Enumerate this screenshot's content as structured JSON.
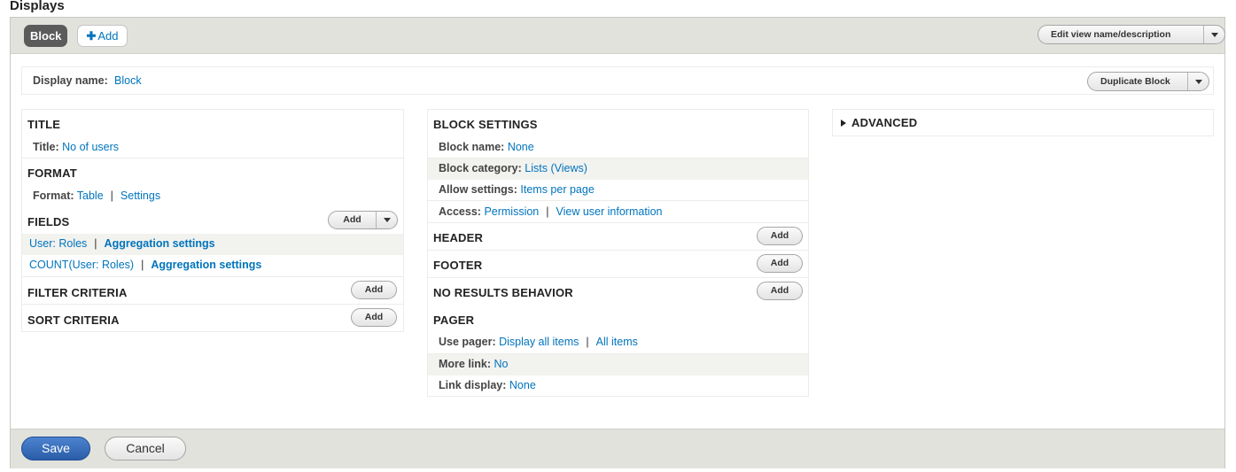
{
  "page": {
    "heading": "Displays"
  },
  "tabs": {
    "block": "Block",
    "add": "Add",
    "add_icon": "plus-icon"
  },
  "top_actions": {
    "edit_label": "Edit view name/description",
    "duplicate_label": "Duplicate Block"
  },
  "display": {
    "name_label": "Display name:",
    "name_value": "Block"
  },
  "left": {
    "title": {
      "heading": "TITLE",
      "label": "Title:",
      "value": "No of users"
    },
    "format": {
      "heading": "FORMAT",
      "label": "Format:",
      "value": "Table",
      "settings": "Settings"
    },
    "fields": {
      "heading": "FIELDS",
      "add": "Add",
      "items": [
        {
          "value": "User: Roles",
          "agg": "Aggregation settings"
        },
        {
          "value": "COUNT(User: Roles)",
          "agg": "Aggregation settings"
        }
      ]
    },
    "filter": {
      "heading": "FILTER CRITERIA",
      "add": "Add"
    },
    "sort": {
      "heading": "SORT CRITERIA",
      "add": "Add"
    }
  },
  "middle": {
    "block_settings": {
      "heading": "BLOCK SETTINGS",
      "name_label": "Block name:",
      "name_value": "None",
      "category_label": "Block category:",
      "category_value": "Lists (Views)",
      "allow_label": "Allow settings:",
      "allow_value": "Items per page",
      "access_label": "Access:",
      "access_value": "Permission",
      "access_value2": "View user information"
    },
    "header": {
      "heading": "HEADER",
      "add": "Add"
    },
    "footer": {
      "heading": "FOOTER",
      "add": "Add"
    },
    "no_results": {
      "heading": "NO RESULTS BEHAVIOR",
      "add": "Add"
    },
    "pager": {
      "heading": "PAGER",
      "use_label": "Use pager:",
      "use_value": "Display all items",
      "use_value2": "All items",
      "more_label": "More link:",
      "more_value": "No",
      "link_label": "Link display:",
      "link_value": "None"
    }
  },
  "right": {
    "advanced": "ADVANCED"
  },
  "footer_actions": {
    "save": "Save",
    "cancel": "Cancel"
  }
}
